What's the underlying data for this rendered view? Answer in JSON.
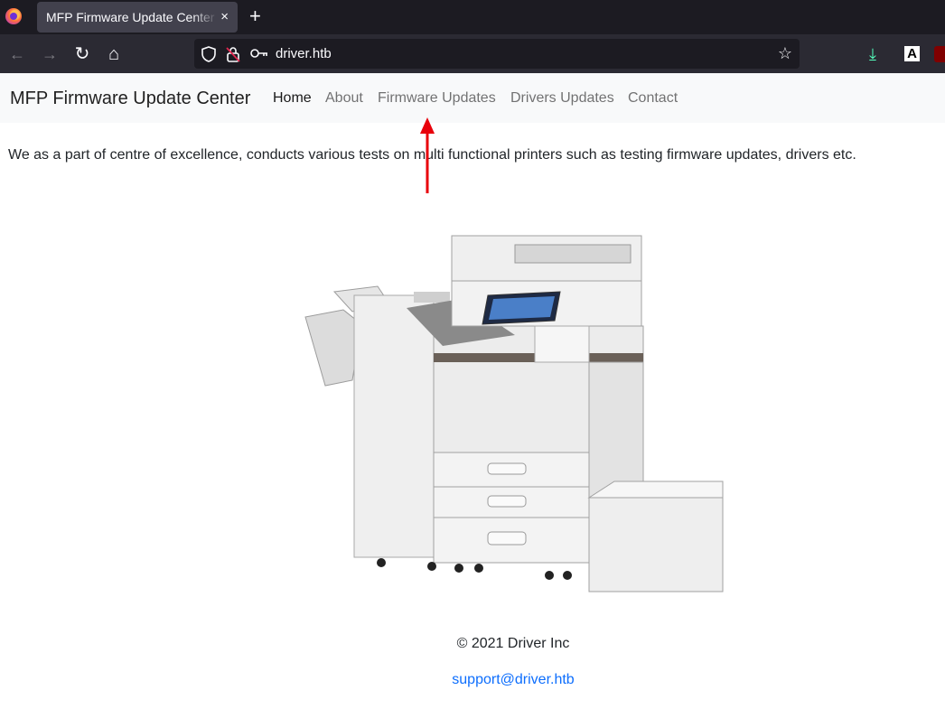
{
  "browser": {
    "tab_title": "MFP Firmware Update Center",
    "tab_close": "×",
    "new_tab": "+",
    "url": "driver.htb",
    "back": "←",
    "forward": "→",
    "reload": "↻",
    "home": "⌂",
    "bookmark_star": "☆",
    "download": "⤓",
    "ext_a": "A"
  },
  "site": {
    "brand": "MFP Firmware Update Center",
    "nav": [
      "Home",
      "About",
      "Firmware Updates",
      "Drivers Updates",
      "Contact"
    ],
    "active_nav": "Home",
    "intro": "We as a part of centre of excellence, conducts various tests on multi functional printers such as testing firmware updates, drivers etc.",
    "footer_copyright": "© 2021 Driver Inc",
    "footer_email": "support@driver.htb"
  },
  "colors": {
    "annotation_arrow": "#e8000b",
    "link": "#0d6efd",
    "navbar_bg": "#f8f9fa"
  }
}
